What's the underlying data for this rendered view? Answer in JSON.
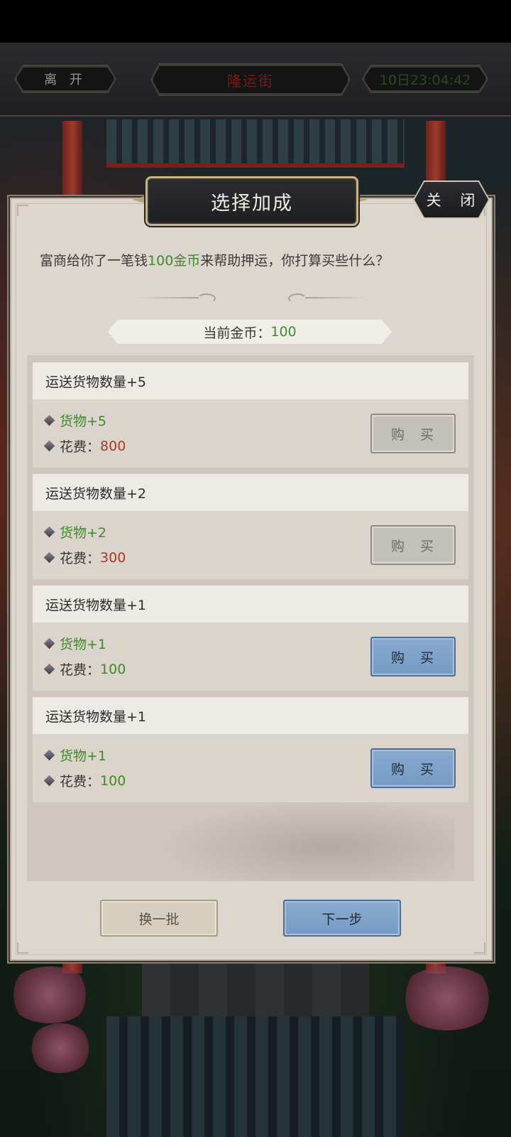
{
  "top_bar": {
    "leave_label": "离 开",
    "location": "隆运街",
    "datetime": "10日23:04:42"
  },
  "dialog": {
    "title": "选择加成",
    "close_label": "关 闭",
    "prompt": {
      "before": "富商给你了一笔钱",
      "amount": "100金币",
      "after": "来帮助押运，你打算买些什么？"
    },
    "gold": {
      "label": "当前金币：",
      "value": "100"
    },
    "items": [
      {
        "title": "运送货物数量+5",
        "goods": "货物+5",
        "cost_label": "花费：",
        "cost": "800",
        "buy_label": "购 买",
        "affordable": false
      },
      {
        "title": "运送货物数量+2",
        "goods": "货物+2",
        "cost_label": "花费：",
        "cost": "300",
        "buy_label": "购 买",
        "affordable": false
      },
      {
        "title": "运送货物数量+1",
        "goods": "货物+1",
        "cost_label": "花费：",
        "cost": "100",
        "buy_label": "购 买",
        "affordable": true
      },
      {
        "title": "运送货物数量+1",
        "goods": "货物+1",
        "cost_label": "花费：",
        "cost": "100",
        "buy_label": "购 买",
        "affordable": true
      }
    ],
    "swap_label": "换一批",
    "next_label": "下一步"
  },
  "colors": {
    "affordable": "#3f8a28",
    "unaffordable": "#a83a2a",
    "location_text": "#7a1a16",
    "datetime_text": "#274a25"
  }
}
